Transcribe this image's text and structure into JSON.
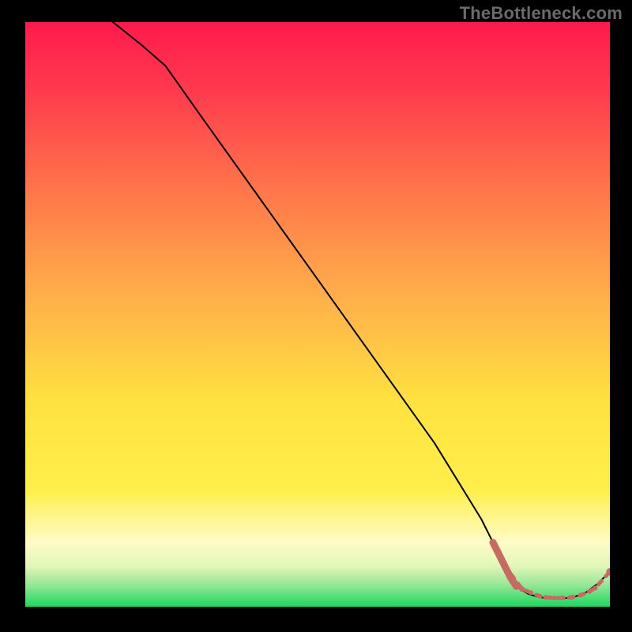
{
  "watermark": "TheBottleneck.com",
  "colors": {
    "black": "#000000",
    "line": "#000000",
    "marker": "#c96a62",
    "gradient_top": "#ff1a4d",
    "gradient_mid_orange": "#ff944d",
    "gradient_yellow": "#ffe84a",
    "gradient_pale": "#fffbc7",
    "gradient_green_light": "#8ce58a",
    "gradient_green": "#1ed760"
  },
  "chart_data": {
    "type": "line",
    "title": "",
    "xlabel": "",
    "ylabel": "",
    "xlim": [
      0,
      100
    ],
    "ylim": [
      0,
      100
    ],
    "series": [
      {
        "name": "bottleneck-curve",
        "x": [
          0,
          10,
          20,
          24,
          30,
          40,
          50,
          60,
          70,
          78,
          80,
          82,
          84,
          86,
          88,
          90,
          92,
          94,
          96,
          98,
          100
        ],
        "y": [
          112,
          104,
          96,
          92.5,
          84,
          70,
          56,
          42,
          28,
          15,
          11,
          7,
          3.5,
          2.2,
          1.6,
          1.4,
          1.4,
          1.7,
          2.5,
          4.0,
          6.0
        ]
      }
    ],
    "markers": {
      "name": "highlight-points",
      "x": [
        82,
        85,
        86.5,
        88,
        89,
        90.5,
        92,
        93.5,
        95,
        96.5,
        97.5,
        100
      ],
      "y": [
        7,
        3.0,
        2.4,
        1.8,
        1.6,
        1.5,
        1.5,
        1.6,
        2.0,
        2.6,
        3.2,
        6.0
      ],
      "r": [
        4,
        3.5,
        3,
        3,
        3,
        3,
        3,
        3,
        3,
        3,
        3,
        4.5
      ]
    },
    "thick_segment": {
      "name": "thick-marker-run",
      "x": [
        80,
        81,
        82,
        83,
        84
      ],
      "y": [
        11,
        9,
        7,
        5,
        3.5
      ]
    }
  }
}
